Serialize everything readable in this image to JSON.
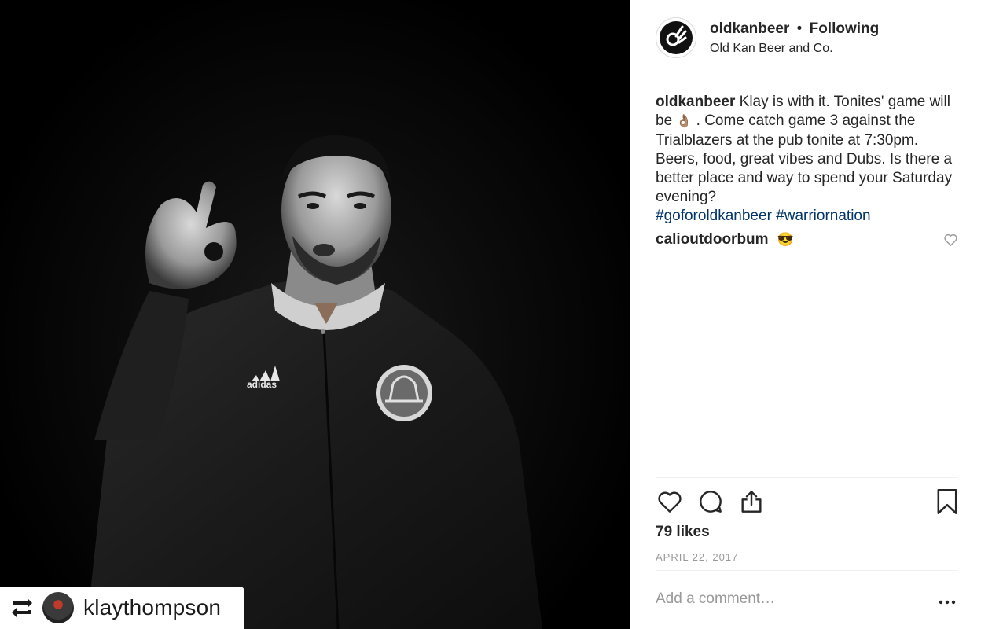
{
  "repost": {
    "username": "klaythompson",
    "icon": "repost-icon"
  },
  "post": {
    "author": "oldkanbeer",
    "separator": "•",
    "follow_status": "Following",
    "location": "Old Kan Beer and Co.",
    "caption_user": "oldkanbeer",
    "caption_text_1": "Klay is with it. Tonites' game will be",
    "caption_emoji": "👌🏽",
    "caption_text_2": ". Come catch game 3 against the Trialblazers at the pub tonite at 7:30pm. Beers, food, great vibes and Dubs. Is there a better place and way to spend your Saturday evening?",
    "hashtags": [
      "#goforoldkanbeer",
      "#warriornation"
    ],
    "likes": "79 likes",
    "date": "APRIL 22, 2017"
  },
  "comments": [
    {
      "user": "calioutdoorbum",
      "text": "😎"
    }
  ],
  "composer": {
    "placeholder": "Add a comment…",
    "more_label": "•••"
  },
  "photo": {
    "jersey_brand": "adidas"
  },
  "colors": {
    "hashtag": "#003569",
    "muted": "#999999",
    "text": "#262626",
    "divider": "#efefef"
  }
}
